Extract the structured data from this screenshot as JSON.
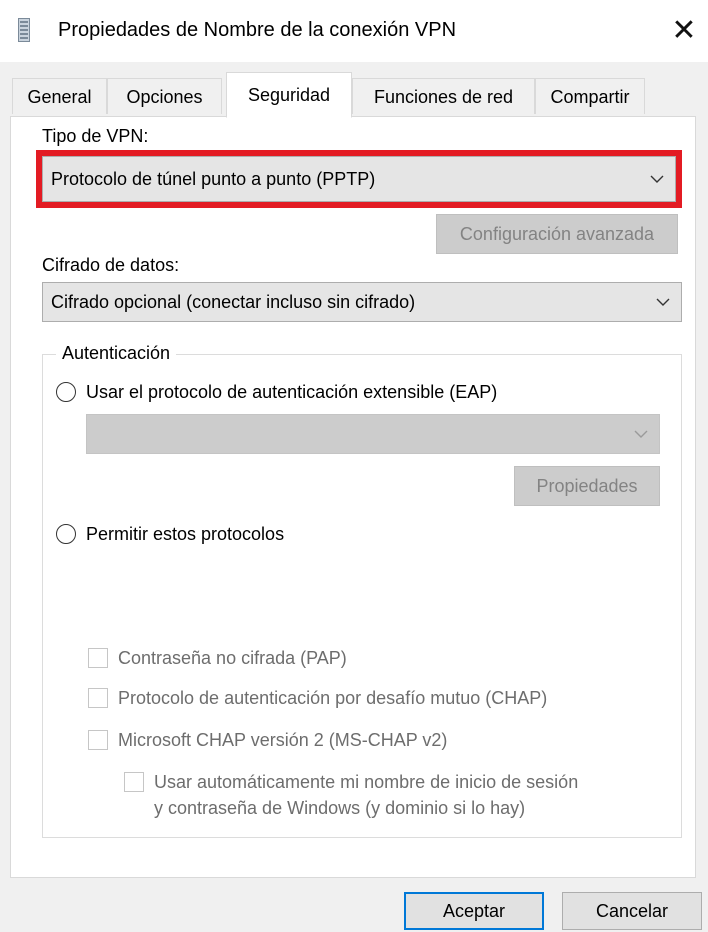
{
  "window": {
    "title": "Propiedades de Nombre de la conexión VPN",
    "close_symbol": "✕",
    "icon": "document-icon"
  },
  "tabs": [
    {
      "label": "General",
      "active": false
    },
    {
      "label": "Opciones",
      "active": false
    },
    {
      "label": "Seguridad",
      "active": true
    },
    {
      "label": "Funciones de red",
      "active": false
    },
    {
      "label": "Compartir",
      "active": false
    }
  ],
  "security": {
    "vpn_type_label": "Tipo de VPN:",
    "vpn_type_value": "Protocolo de túnel punto a punto (PPTP)",
    "advanced_button": "Configuración avanzada",
    "encryption_label": "Cifrado de datos:",
    "encryption_value": "Cifrado opcional (conectar incluso sin cifrado)",
    "auth_group_label": "Autenticación",
    "eap_radio": "Usar el protocolo de autenticación extensible (EAP)",
    "eap_combo_value": "",
    "properties_button": "Propiedades",
    "allow_protocols_radio": "Permitir estos protocolos",
    "protocols": [
      {
        "label": "Contraseña no cifrada (PAP)",
        "checked": false
      },
      {
        "label": "Protocolo de autenticación por desafío mutuo (CHAP)",
        "checked": false
      },
      {
        "label": "Microsoft CHAP versión 2 (MS-CHAP v2)",
        "checked": false
      }
    ],
    "auto_logon_line1": "Usar automáticamente mi nombre de inicio de sesión",
    "auto_logon_line2": "y contraseña de Windows (y dominio si lo hay)"
  },
  "footer": {
    "ok_button": "Aceptar",
    "cancel_button": "Cancelar"
  },
  "colors": {
    "highlight": "#e31b23",
    "accent_border": "#0078d7",
    "window_bg": "#f0f0f0",
    "panel_bg": "#ffffff"
  }
}
